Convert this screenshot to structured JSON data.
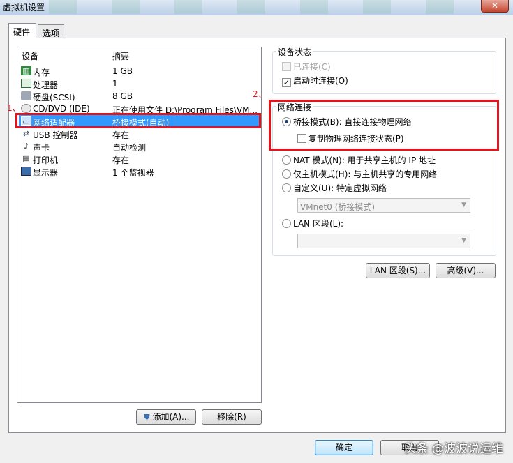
{
  "window": {
    "title": "虚拟机设置",
    "close_symbol": "✕"
  },
  "tabs": [
    {
      "label": "硬件"
    },
    {
      "label": "选项"
    }
  ],
  "devices": {
    "header_device": "设备",
    "header_summary": "摘要",
    "rows": [
      {
        "name": "内存",
        "summary": "1 GB",
        "icon": "memory-icon"
      },
      {
        "name": "处理器",
        "summary": "1",
        "icon": "cpu-icon"
      },
      {
        "name": "硬盘(SCSI)",
        "summary": "8 GB",
        "icon": "harddisk-icon"
      },
      {
        "name": "CD/DVD (IDE)",
        "summary": "正在使用文件 D:\\Program Files\\VM...",
        "icon": "cd-icon"
      },
      {
        "name": "网络适配器",
        "summary": "桥接模式(自动)",
        "icon": "network-adapter-icon"
      },
      {
        "name": "USB 控制器",
        "summary": "存在",
        "icon": "usb-icon"
      },
      {
        "name": "声卡",
        "summary": "自动检测",
        "icon": "sound-icon"
      },
      {
        "name": "打印机",
        "summary": "存在",
        "icon": "printer-icon"
      },
      {
        "name": "显示器",
        "summary": "1 个监视器",
        "icon": "monitor-icon"
      }
    ]
  },
  "annotations": {
    "mark1": "1、",
    "mark2": "2、"
  },
  "device_status": {
    "title": "设备状态",
    "connected": "已连接(C)",
    "connect_on_power": "启动时连接(O)"
  },
  "network": {
    "title": "网络连接",
    "bridged": "桥接模式(B): 直接连接物理网络",
    "replicate": "复制物理网络连接状态(P)",
    "nat": "NAT 模式(N): 用于共享主机的 IP 地址",
    "hostonly": "仅主机模式(H): 与主机共享的专用网络",
    "custom": "自定义(U): 特定虚拟网络",
    "custom_select": "VMnet0 (桥接模式)",
    "lan": "LAN 区段(L):",
    "lan_select": ""
  },
  "buttons": {
    "lan_segments": "LAN 区段(S)...",
    "advanced": "高级(V)...",
    "add": "添加(A)...",
    "remove": "移除(R)",
    "ok": "确定",
    "cancel": "取消"
  },
  "watermark": "头条 @波波说运维",
  "colors": {
    "selection": "#3399ff",
    "annotation_red": "#e3141b"
  }
}
